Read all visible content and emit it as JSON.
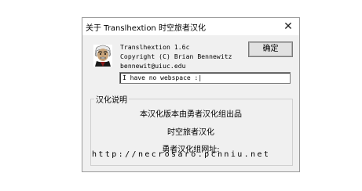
{
  "window": {
    "title": "关于 Translhextion  时空旅者汉化",
    "close_glyph": "✕"
  },
  "about": {
    "icon": "einstein-portrait-icon",
    "app_name_version": "Translhextion 1.6c",
    "copyright": "Copyright (C) Brian Bennewitz",
    "email": "bennewit@uiuc.edu",
    "ok_label": "确定",
    "web_field_value": "I have no webspace :|"
  },
  "localization": {
    "group_label": "汉化说明",
    "line1": "本汉化版本由勇者汉化组出品",
    "line2": "时空旅者汉化",
    "line3": "勇者汉化组网址:",
    "url": "http://necrosaro.pcnniu.net"
  },
  "colors": {
    "dialog_bg": "#f0f0f0",
    "titlebar_bg": "#ffffff",
    "button_bg": "#e1e1e1"
  }
}
